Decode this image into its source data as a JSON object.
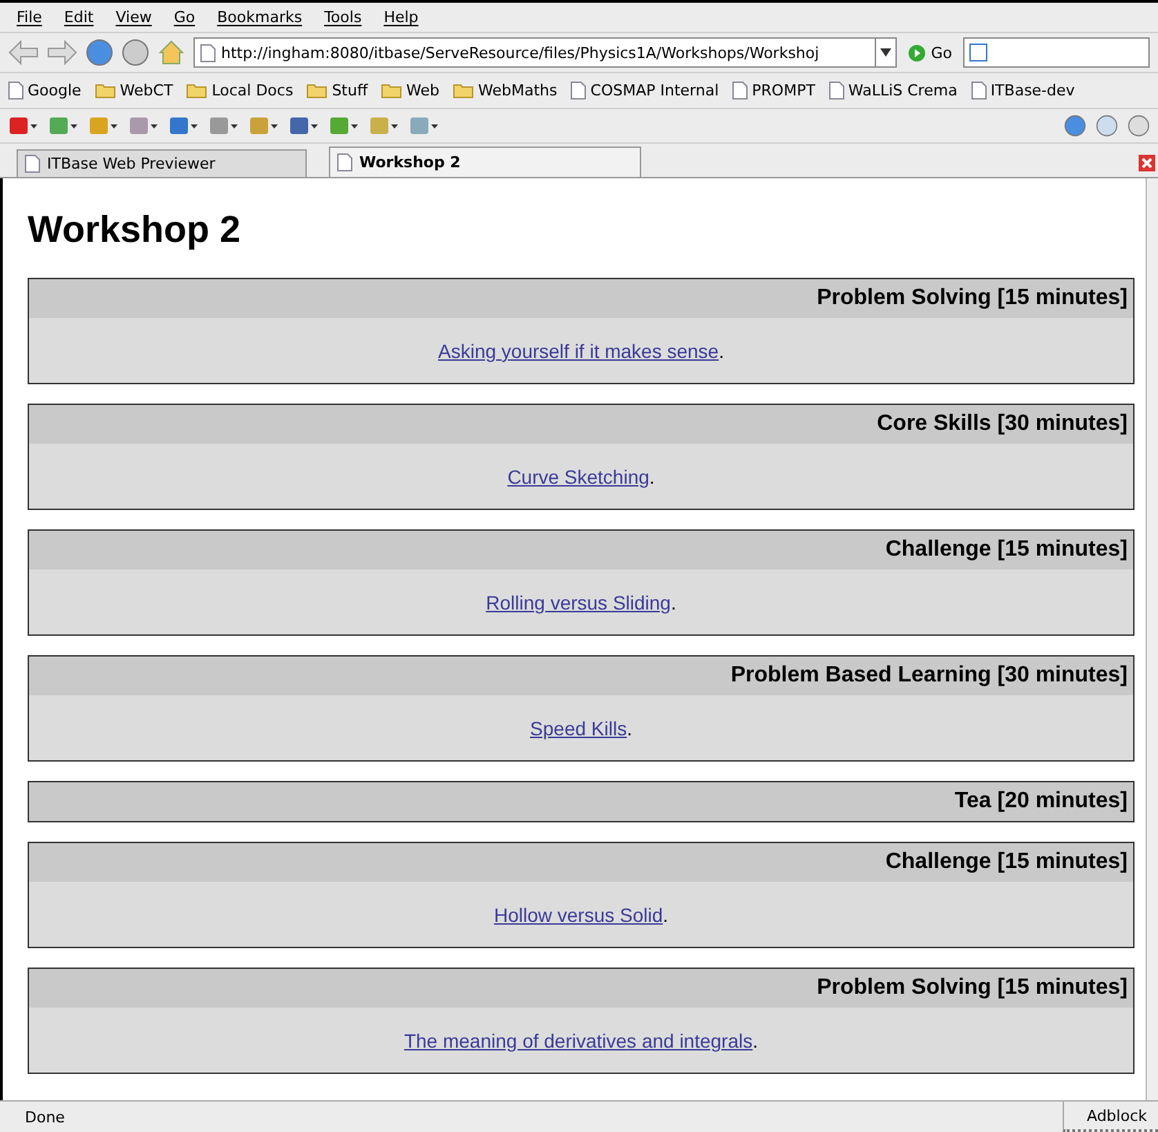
{
  "menu": [
    "File",
    "Edit",
    "View",
    "Go",
    "Bookmarks",
    "Tools",
    "Help"
  ],
  "address": {
    "value": "http://ingham:8080/itbase/ServeResource/files/Physics1A/Workshops/Workshoj",
    "go": "Go"
  },
  "bookmarks": [
    {
      "label": "Google",
      "kind": "page"
    },
    {
      "label": "WebCT",
      "kind": "folder"
    },
    {
      "label": "Local Docs",
      "kind": "folder"
    },
    {
      "label": "Stuff",
      "kind": "folder"
    },
    {
      "label": "Web",
      "kind": "folder"
    },
    {
      "label": "WebMaths",
      "kind": "folder"
    },
    {
      "label": "COSMAP Internal",
      "kind": "page"
    },
    {
      "label": "PROMPT",
      "kind": "page"
    },
    {
      "label": "WaLLiS Crema",
      "kind": "page"
    },
    {
      "label": "ITBase-dev",
      "kind": "page"
    }
  ],
  "tabs": [
    {
      "label": "ITBase Web Previewer",
      "selected": false
    },
    {
      "label": "Workshop 2",
      "selected": true
    }
  ],
  "page": {
    "title": "Workshop 2",
    "sections": [
      {
        "heading": "Problem Solving [15 minutes]",
        "link": "Asking yourself if it makes sense",
        "after": "."
      },
      {
        "heading": "Core Skills [30 minutes]",
        "link": "Curve Sketching",
        "after": "."
      },
      {
        "heading": "Challenge [15 minutes]",
        "link": "Rolling versus Sliding",
        "after": "."
      },
      {
        "heading": "Problem Based Learning [30 minutes]",
        "link": "Speed Kills",
        "after": "."
      },
      {
        "heading": "Tea [20 minutes]"
      },
      {
        "heading": "Challenge [15 minutes]",
        "link": "Hollow versus Solid",
        "after": "."
      },
      {
        "heading": "Problem Solving [15 minutes]",
        "link": "The meaning of derivatives and integrals",
        "after": "."
      }
    ]
  },
  "status_bar": {
    "text": "Done",
    "panel": "Adblock"
  }
}
